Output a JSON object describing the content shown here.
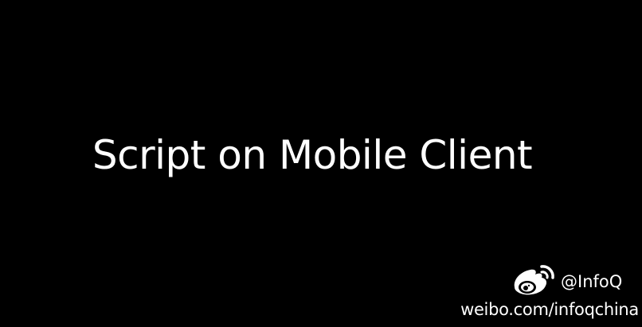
{
  "slide": {
    "title": "Script on Mobile Client",
    "background_color": "#000000",
    "text_color": "#ffffff"
  },
  "watermark": {
    "logo_icon": "weibo-logo-icon",
    "handle": "@InfoQ",
    "url": "weibo.com/infoqchina"
  }
}
